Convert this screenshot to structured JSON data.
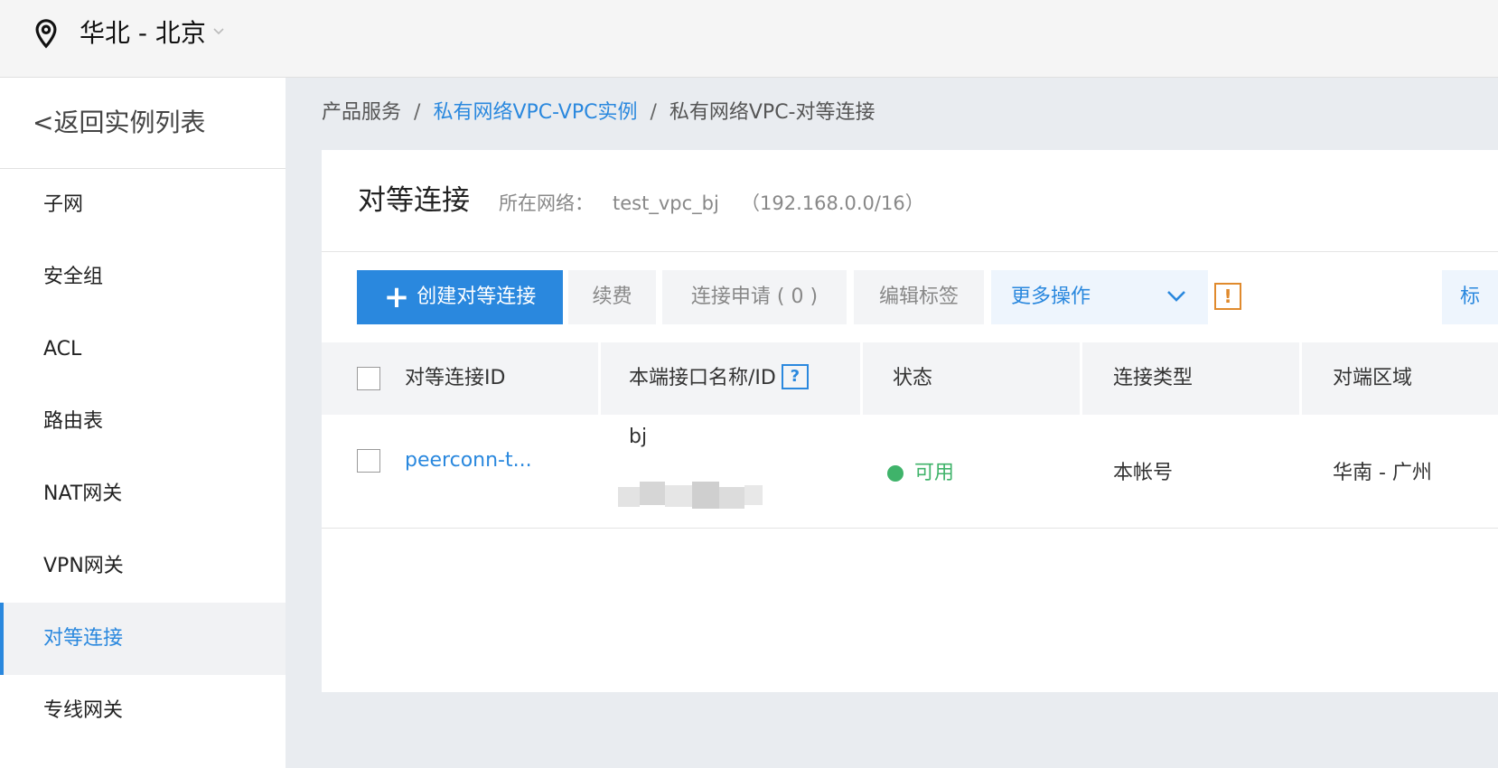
{
  "topbar": {
    "region": "华北 - 北京"
  },
  "sidebar": {
    "back_label": "<返回实例列表",
    "items": [
      {
        "label": "子网"
      },
      {
        "label": "安全组"
      },
      {
        "label": "ACL"
      },
      {
        "label": "路由表"
      },
      {
        "label": "NAT网关"
      },
      {
        "label": "VPN网关"
      },
      {
        "label": "对等连接",
        "active": true
      },
      {
        "label": "专线网关"
      }
    ]
  },
  "breadcrumb": {
    "root": "产品服务",
    "parent": "私有网络VPC-VPC实例",
    "current": "私有网络VPC-对等连接",
    "separator": "/"
  },
  "header": {
    "title": "对等连接",
    "network_label": "所在网络：",
    "network_name": "test_vpc_bj",
    "network_cidr": "（192.168.0.0/16）"
  },
  "toolbar": {
    "create_label": "创建对等连接",
    "renew_label": "续费",
    "request_label": "连接申请 ( 0 )",
    "edit_tags_label": "编辑标签",
    "more_label": "更多操作",
    "tags_label": "标签",
    "warning_glyph": "!"
  },
  "table": {
    "columns": [
      "对等连接ID",
      "本端接口名称/ID",
      "状态",
      "连接类型",
      "对端区域"
    ],
    "help_glyph": "?",
    "rows": [
      {
        "id": "peerconn-t...",
        "local_name": "bj",
        "status": "可用",
        "type": "本帐号",
        "peer_region": "华南 - 广州"
      }
    ]
  },
  "colors": {
    "accent": "#2a88de",
    "status_ok": "#3fb36a",
    "warning": "#e08a2d"
  }
}
